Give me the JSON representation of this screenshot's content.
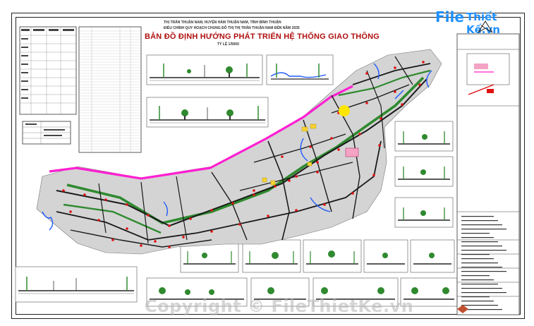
{
  "header": {
    "sub_line_1": "THỊ TRẤN THUẬN NAM, HUYỆN HÀM THUẬN NAM, TỈNH BÌNH THUẬN",
    "sub_line_2": "ĐIỀU CHỈNH QUY HOẠCH CHUNG ĐÔ THỊ THỊ TRẤN THUẬN NAM ĐẾN NĂM 2035",
    "title": "BẢN ĐỒ ĐỊNH HƯỚNG PHÁT TRIỂN HỆ THỐNG GIAO THÔNG",
    "scale": "TỶ LỆ 1/5000"
  },
  "brand": {
    "logo_file": "File",
    "logo_rest": "Thiết Kế.vn",
    "watermark": "Copyright © FileThietKe.vn"
  },
  "colors": {
    "road_main": "#1a1a1a",
    "road_magenta": "#ff1fd2",
    "road_green": "#2f8a2f",
    "water": "#1e5bff",
    "node_red": "#e01010",
    "sun_yellow": "#ffe600",
    "urban_fill": "#cfcfcf"
  },
  "icons": [
    "compass-north-icon",
    "logo-cube-icon"
  ]
}
